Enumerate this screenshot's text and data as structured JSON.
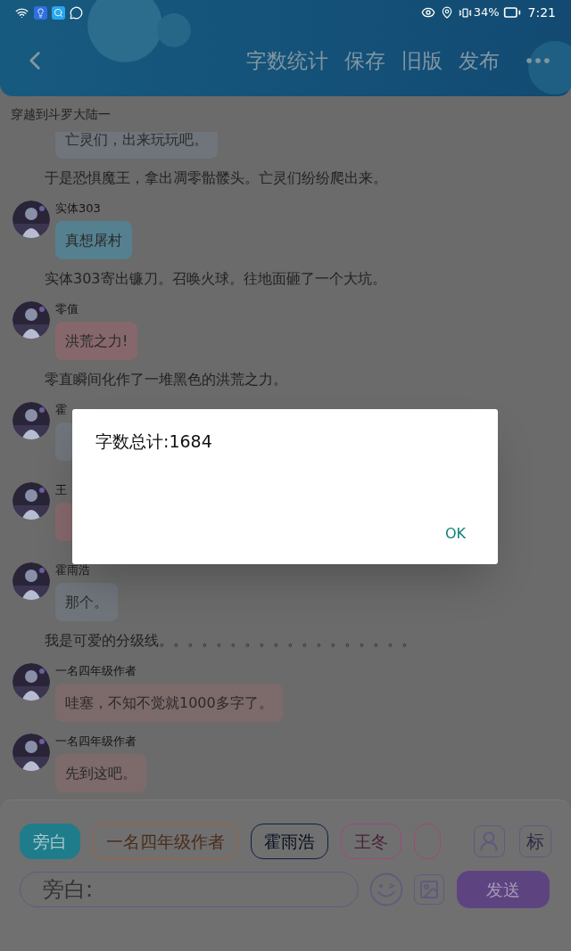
{
  "status_bar": {
    "battery": "34%",
    "time": "7:21"
  },
  "toolbar": {
    "actions": [
      "字数统计",
      "保存",
      "旧版",
      "发布"
    ]
  },
  "story_title": "穿越到斗罗大陆一",
  "messages": [
    {
      "kind": "bubble",
      "text": "亡灵们，出来玩玩吧。",
      "color": "#6f757b"
    },
    {
      "kind": "narration",
      "text": "于是恐惧魔王，拿出凋零骷髅头。亡灵们纷纷爬出来。"
    },
    {
      "kind": "bubble",
      "name": "实体303",
      "text": "真想屠村",
      "color": "#55808f"
    },
    {
      "kind": "narration",
      "text": "实体303寄出镰刀。召唤火球。往地面砸了一个大坑。"
    },
    {
      "kind": "bubble",
      "name": "零值",
      "text": "洪荒之力!",
      "color": "#86686c"
    },
    {
      "kind": "narration",
      "text": "零直瞬间化作了一堆黑色的洪荒之力。"
    },
    {
      "kind": "bubble",
      "name": "霍",
      "color": "#6f757b"
    },
    {
      "kind": "bubble",
      "name": "王",
      "color": "#86686c"
    },
    {
      "kind": "bubble",
      "name": "霍雨浩",
      "text": "那个。",
      "color": "#6f757b"
    },
    {
      "kind": "narration",
      "text": "我是可爱的分级线。。。。。。。。。。。。。。。。。。"
    },
    {
      "kind": "bubble",
      "name": "一名四年级作者",
      "text": "哇塞，不知不觉就1000多字了。",
      "color": "#7d6a6b"
    },
    {
      "kind": "bubble",
      "name": "一名四年级作者",
      "text": "先到这吧。",
      "color": "#7d6a6b"
    }
  ],
  "dialog": {
    "message": "字数总计:1684",
    "button": "OK"
  },
  "composer": {
    "chips": [
      {
        "label": "旁白",
        "color": "#1f7d8b",
        "selected": true
      },
      {
        "label": "一名四年级作者",
        "color": "#a4633c",
        "selected": false
      },
      {
        "label": "霍雨浩",
        "color": "#0e1f45",
        "selected": false
      },
      {
        "label": "王冬",
        "color": "#a0477f",
        "selected": false
      },
      {
        "color": "#a04a70",
        "selected": false
      }
    ],
    "tag_button": "标",
    "input": {
      "placeholder": "旁白:"
    },
    "send": "发送"
  }
}
